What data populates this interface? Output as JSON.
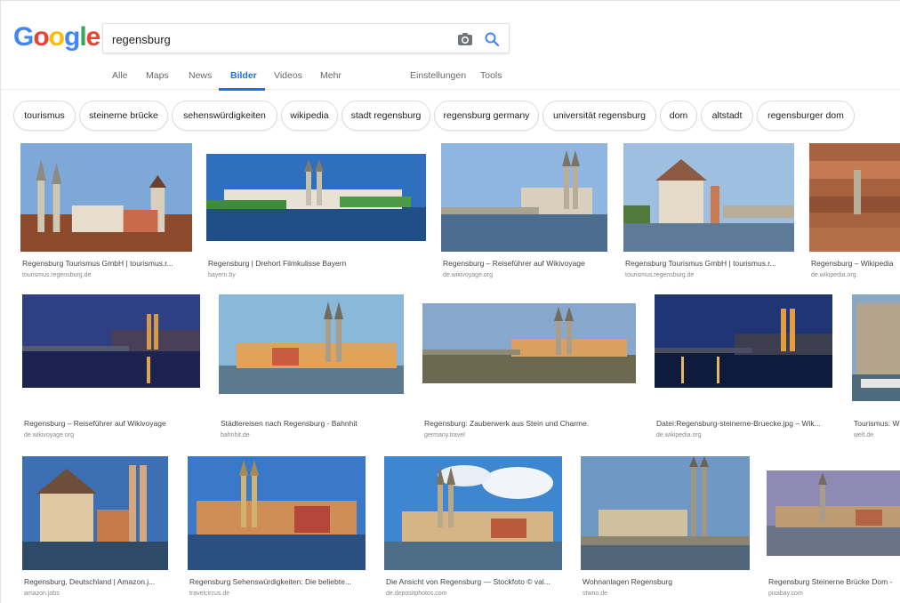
{
  "search": {
    "query": "regensburg"
  },
  "logo": {
    "letters": [
      "G",
      "o",
      "o",
      "g",
      "l",
      "e"
    ],
    "colors": [
      "#4285f4",
      "#ea4335",
      "#fbbc05",
      "#4285f4",
      "#34a853",
      "#ea4335"
    ]
  },
  "tabs": [
    {
      "label": "Alle"
    },
    {
      "label": "Maps"
    },
    {
      "label": "News"
    },
    {
      "label": "Bilder"
    },
    {
      "label": "Videos"
    },
    {
      "label": "Mehr"
    },
    {
      "label": "Einstellungen"
    },
    {
      "label": "Tools"
    }
  ],
  "chips": [
    {
      "label": "tourismus"
    },
    {
      "label": "steinerne brücke"
    },
    {
      "label": "sehenswürdigkeiten"
    },
    {
      "label": "wikipedia"
    },
    {
      "label": "stadt regensburg"
    },
    {
      "label": "regensburg germany"
    },
    {
      "label": "universität regensburg"
    },
    {
      "label": "dom"
    },
    {
      "label": "altstadt"
    },
    {
      "label": "regensburger dom"
    }
  ],
  "results": [
    {
      "title": "Regensburg Tourismus GmbH | tourismus.r...",
      "site": "tourismus.regensburg.de"
    },
    {
      "title": "Regensburg | Drehort Filmkulisse Bayern",
      "site": "bayern.by"
    },
    {
      "title": "Regensburg – Reiseführer auf Wikivoyage",
      "site": "de.wikivoyage.org"
    },
    {
      "title": "Regensburg Tourismus GmbH | tourismus.r...",
      "site": "tourismus.regensburg.de"
    },
    {
      "title": "Regensburg – Wikipedia",
      "site": "de.wikipedia.org"
    },
    {
      "title": "Regensburg – Reiseführer auf Wikivoyage",
      "site": "de.wikivoyage.org"
    },
    {
      "title": "Städtereisen nach Regensburg - Bahnhit",
      "site": "bahnhit.de"
    },
    {
      "title": "Regensburg: Zauberwerk aus Stein und Charme.",
      "site": "germany.travel"
    },
    {
      "title": "Datei:Regensburg-steinerne-Bruecke.jpg – Wik...",
      "site": "de.wikipedia.org"
    },
    {
      "title": "Tourismus: W",
      "site": "welt.de"
    },
    {
      "title": "Regensburg, Deutschland | Amazon.j...",
      "site": "amazon.jobs"
    },
    {
      "title": "Regensburg Sehenswürdigkeiten: Die beliebte...",
      "site": "travelcircus.de"
    },
    {
      "title": "Die Ansicht von Regensburg — Stockfoto © val...",
      "site": "de.depositphotos.com"
    },
    {
      "title": "Wohnanlagen Regensburg",
      "site": "stwno.de"
    },
    {
      "title": "Regensburg Steinerne Brücke Dom -",
      "site": "pixabay.com"
    }
  ]
}
